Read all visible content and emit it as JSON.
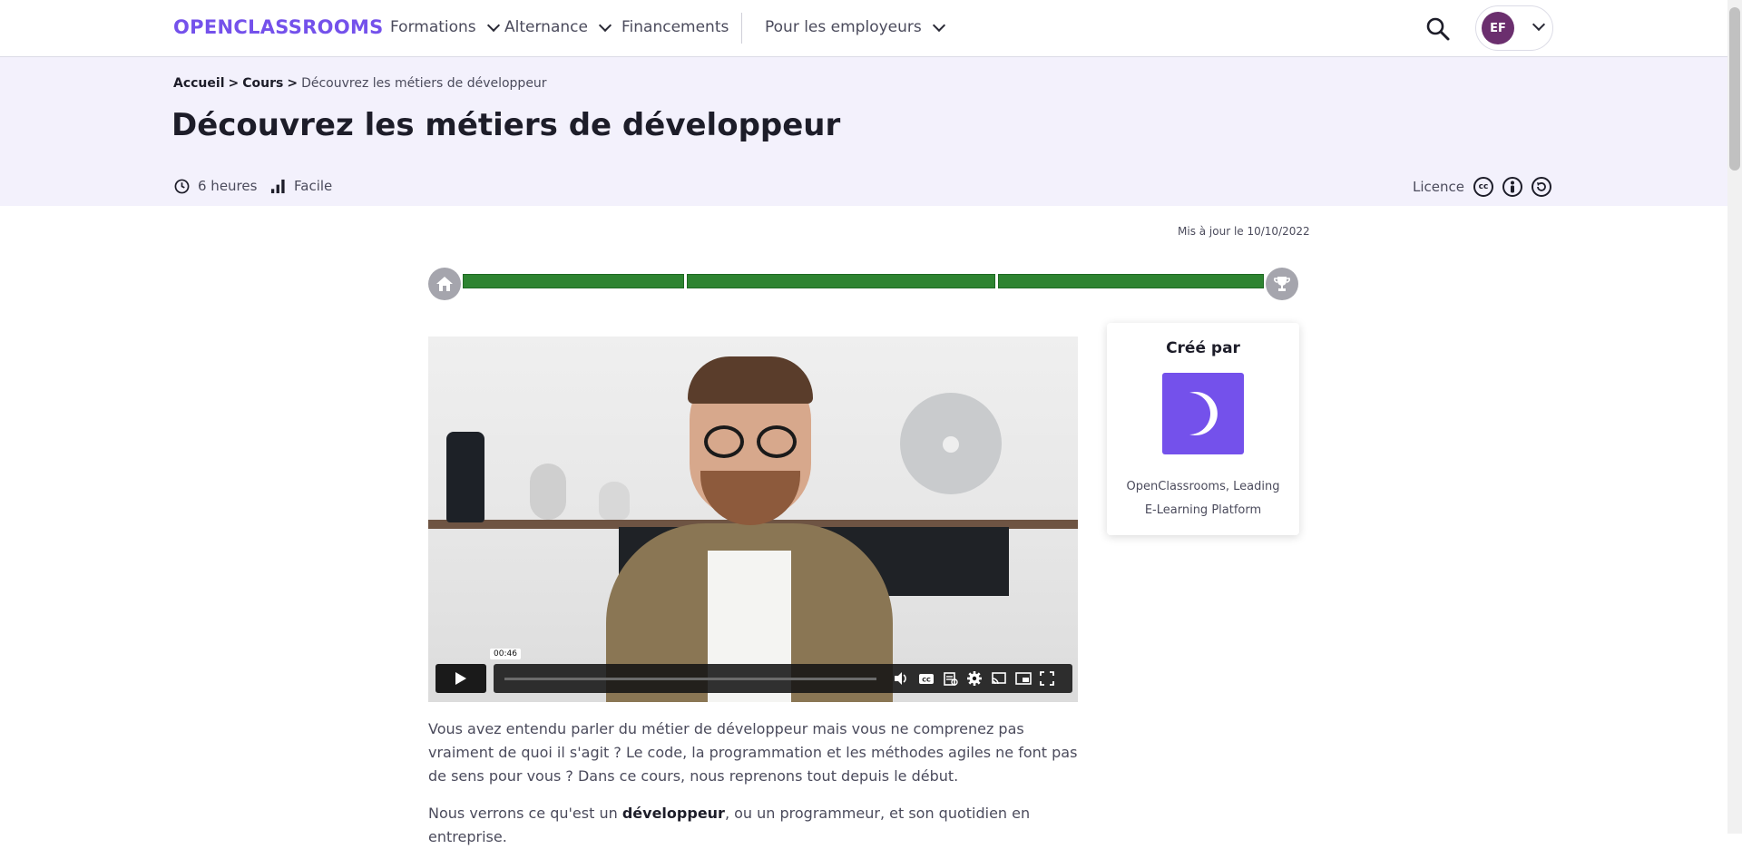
{
  "header": {
    "logo_text": "OPENCLASSROOMS",
    "nav": [
      {
        "label": "Formations",
        "has_dropdown": true
      },
      {
        "label": "Alternance",
        "has_dropdown": true
      },
      {
        "label": "Financements",
        "has_dropdown": false
      },
      {
        "label": "Pour les employeurs",
        "has_dropdown": true
      }
    ],
    "user_initials": "EF",
    "icons": {
      "search": "search-icon",
      "user_menu": "chevron-down-icon"
    }
  },
  "breadcrumb": {
    "items": [
      "Accueil",
      "Cours"
    ],
    "separator": ">",
    "current": "Découvrez les métiers de développeur"
  },
  "course": {
    "title": "Découvrez les métiers de développeur",
    "duration": "6 heures",
    "difficulty": "Facile",
    "licence_label": "Licence",
    "licence_icons": [
      "cc-icon",
      "by-icon",
      "nd-icon"
    ],
    "updated": "Mis à jour le 10/10/2022"
  },
  "progress": {
    "segments": 3,
    "completed_segments": 3,
    "start_icon": "home-icon",
    "end_icon": "trophy-icon"
  },
  "video": {
    "current_time": "00:46",
    "controls": [
      "play",
      "volume",
      "captions",
      "transcript",
      "settings",
      "cast",
      "picture-in-picture",
      "fullscreen"
    ]
  },
  "author": {
    "heading": "Créé par",
    "name_line1": "OpenClassrooms, Leading",
    "name_line2": "E-Learning Platform"
  },
  "description": {
    "paragraph1": "Vous avez entendu parler du métier de développeur mais vous ne comprenez pas vraiment de quoi il s'agit ? Le code, la programmation et les méthodes agiles ne font pas de sens pour vous ? Dans ce cours, nous reprenons tout depuis le début.",
    "paragraph2_prefix": "Nous verrons ce qu'est un ",
    "paragraph2_bold": "développeur",
    "paragraph2_suffix": ", ou un programmeur, et son quotidien en entreprise."
  },
  "colors": {
    "brand": "#7451eb",
    "hero_bg": "#f3f1fc",
    "progress_green": "#2e8431",
    "avatar_bg": "#6b2f6e"
  }
}
